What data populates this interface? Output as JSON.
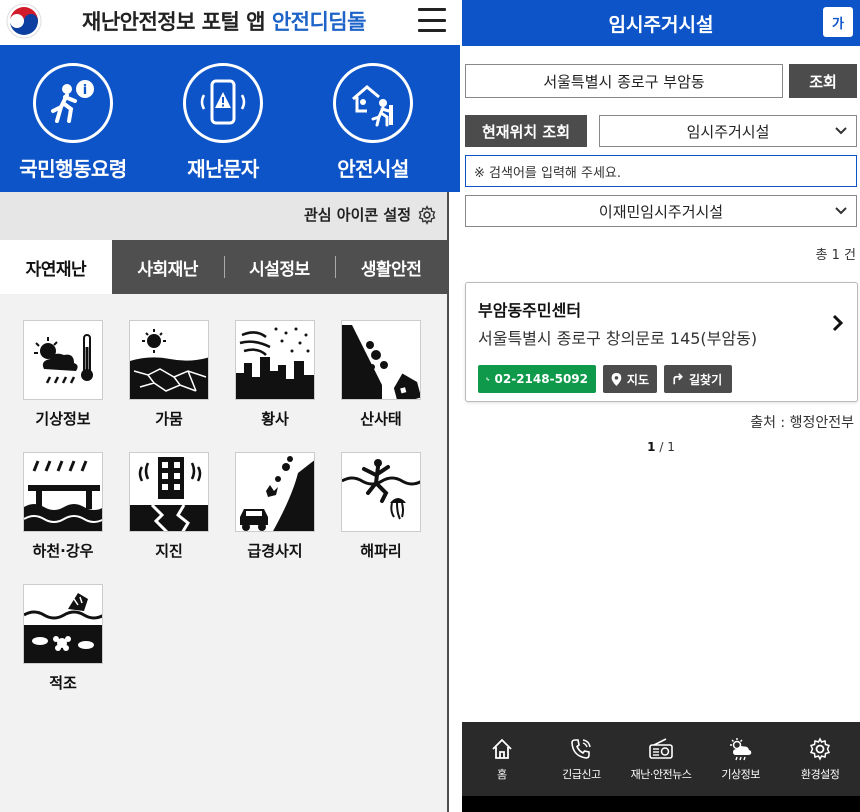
{
  "left": {
    "header": {
      "title_prefix": "재난안전정보 포털 앱 ",
      "title_brand": "안전디딤돌",
      "logo_icon": "taegeuk-logo-icon",
      "menu_icon": "hamburger-icon"
    },
    "hero": [
      {
        "label": "국민행동요령",
        "icon": "running-person-info-icon"
      },
      {
        "label": "재난문자",
        "icon": "phone-alert-icon"
      },
      {
        "label": "안전시설",
        "icon": "shelter-exit-icon"
      }
    ],
    "interest_settings_label": "관심 아이콘 설정",
    "tabs": [
      "자연재난",
      "사회재난",
      "시설정보",
      "생활안전"
    ],
    "active_tab": 0,
    "categories": [
      {
        "label": "기상정보",
        "icon": "weather-icon"
      },
      {
        "label": "가뭄",
        "icon": "drought-icon"
      },
      {
        "label": "황사",
        "icon": "yellow-dust-icon"
      },
      {
        "label": "산사태",
        "icon": "landslide-icon"
      },
      {
        "label": "하천·강우",
        "icon": "river-rain-icon"
      },
      {
        "label": "지진",
        "icon": "earthquake-icon"
      },
      {
        "label": "급경사지",
        "icon": "steep-slope-icon"
      },
      {
        "label": "해파리",
        "icon": "jellyfish-icon"
      },
      {
        "label": "적조",
        "icon": "red-tide-icon"
      }
    ]
  },
  "right": {
    "title": "임시주거시설",
    "font_button": "가",
    "address_value": "서울특별시 종로구 부암동",
    "search_button": "조회",
    "location_button": "현재위치 조회",
    "facility_select": "임시주거시설",
    "search_placeholder": "※ 검색어를 입력해 주세요.",
    "type_select": "이재민임시주거시설",
    "total": "총 1 건",
    "results": [
      {
        "name": "부암동주민센터",
        "address": "서울특별시 종로구 창의문로 145(부암동)",
        "phone": "02-2148-5092",
        "map_label": "지도",
        "route_label": "길찾기"
      }
    ],
    "source": "출처 : 행정안전부",
    "pager_current": "1",
    "pager_total": " / 1",
    "nav": [
      {
        "label": "홈",
        "icon": "home-icon"
      },
      {
        "label": "긴급신고",
        "icon": "phone-icon"
      },
      {
        "label": "재난·안전뉴스",
        "icon": "radio-icon"
      },
      {
        "label": "기상정보",
        "icon": "weather-icon"
      },
      {
        "label": "환경설정",
        "icon": "gear-icon"
      }
    ]
  },
  "colors": {
    "primary": "#0d54c8",
    "tab_bar": "#4f4f4f",
    "call_green": "#0e9a4a",
    "nav_bg": "#2a2a2a"
  }
}
